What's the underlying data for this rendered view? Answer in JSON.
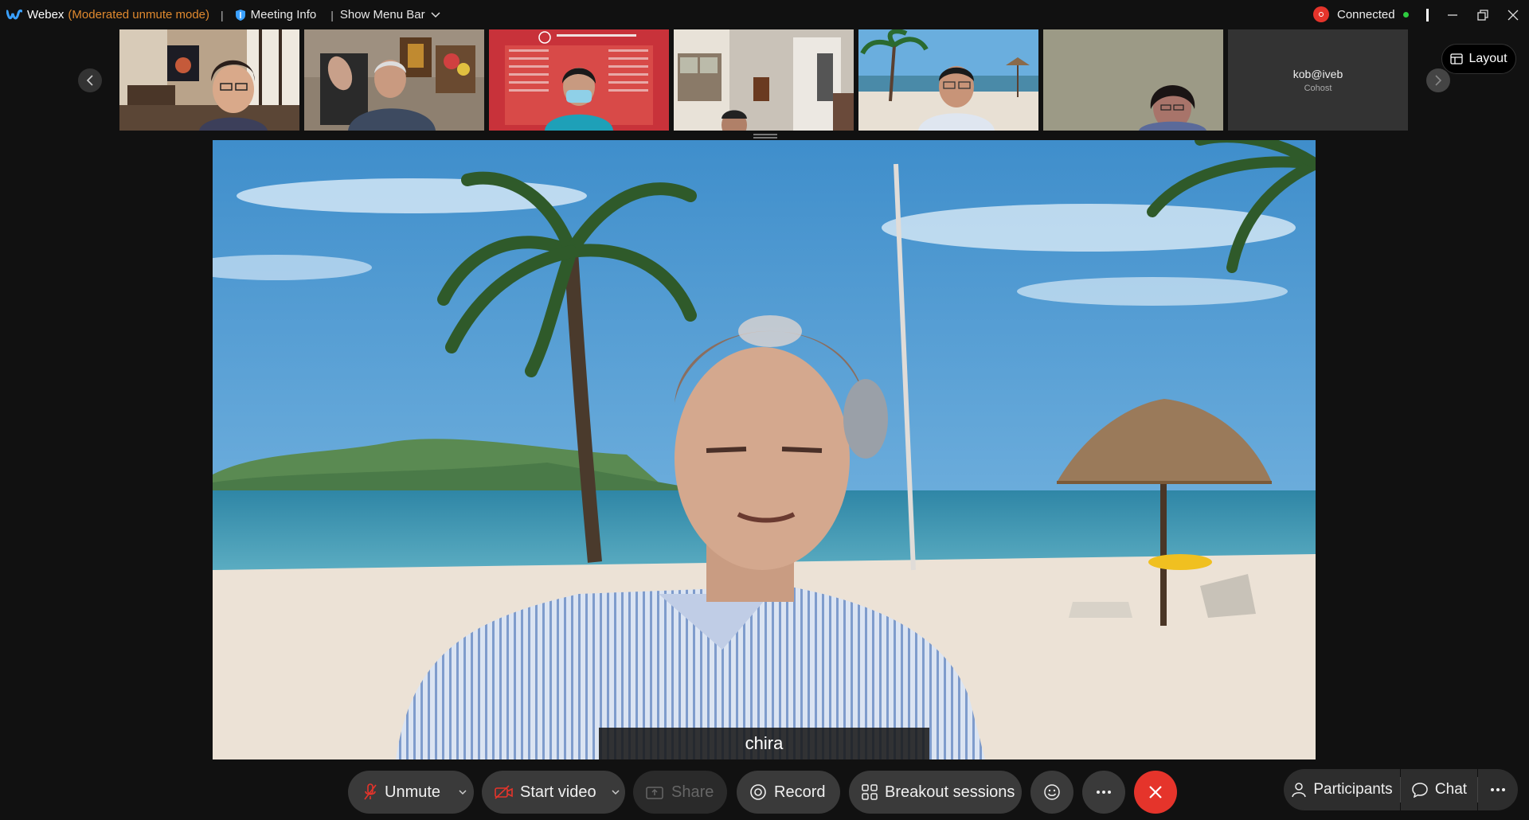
{
  "titlebar": {
    "app_name": "Webex",
    "mode": "(Moderated unmute mode)",
    "meeting_info": "Meeting Info",
    "show_menu_bar": "Show Menu Bar",
    "connection_status": "Connected"
  },
  "thumbnails": [
    {
      "id": "p1"
    },
    {
      "id": "p2"
    },
    {
      "id": "p3"
    },
    {
      "id": "p4"
    },
    {
      "id": "p5"
    },
    {
      "id": "p6"
    },
    {
      "id": "p7",
      "name": "kob@iveb",
      "role": "Cohost"
    }
  ],
  "layout_button": "Layout",
  "main_video": {
    "speaker_name": "chira"
  },
  "controls": {
    "unmute": "Unmute",
    "start_video": "Start video",
    "share": "Share",
    "record": "Record",
    "breakout": "Breakout sessions",
    "participants": "Participants",
    "chat": "Chat"
  },
  "colors": {
    "accent_orange": "#e0892e",
    "end_call_red": "#e5342b",
    "connected_green": "#2ecc40",
    "mic_muted_red": "#e5342b"
  }
}
